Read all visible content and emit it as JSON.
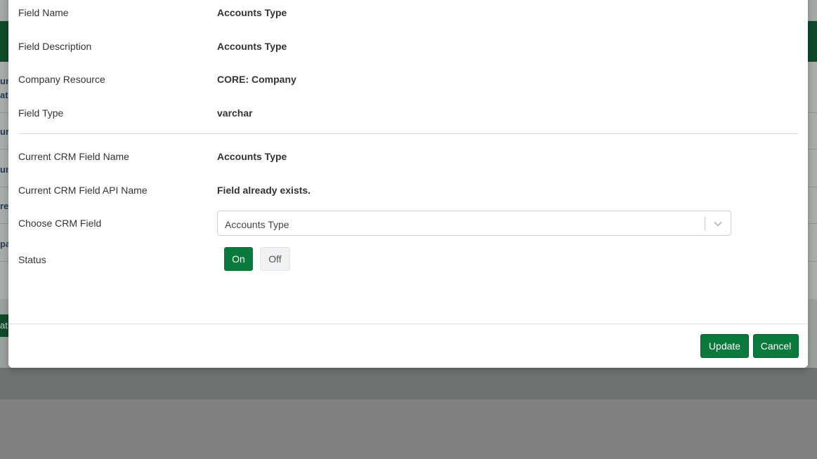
{
  "background": {
    "side_fragments": [
      "un",
      "ate",
      "ur",
      "un",
      "re",
      "pa",
      "at"
    ]
  },
  "modal": {
    "fields": [
      {
        "label": "Field Name",
        "value": "Accounts Type"
      },
      {
        "label": "Field Description",
        "value": "Accounts Type"
      },
      {
        "label": "Company Resource",
        "value": "CORE: Company"
      },
      {
        "label": "Field Type",
        "value": "varchar"
      }
    ],
    "crm_fields": [
      {
        "label": "Current CRM Field Name",
        "value": "Accounts Type"
      },
      {
        "label": "Current CRM Field API Name",
        "value": "Field already exists."
      }
    ],
    "choose_crm_field": {
      "label": "Choose CRM Field",
      "selected": "Accounts Type"
    },
    "status": {
      "label": "Status",
      "on_label": "On",
      "off_label": "Off",
      "active": "On"
    },
    "buttons": {
      "update_label": "Update",
      "cancel_label": "Cancel"
    }
  },
  "colors": {
    "accent_green": "#0a7a3c",
    "header_green": "#0e4a2a"
  }
}
